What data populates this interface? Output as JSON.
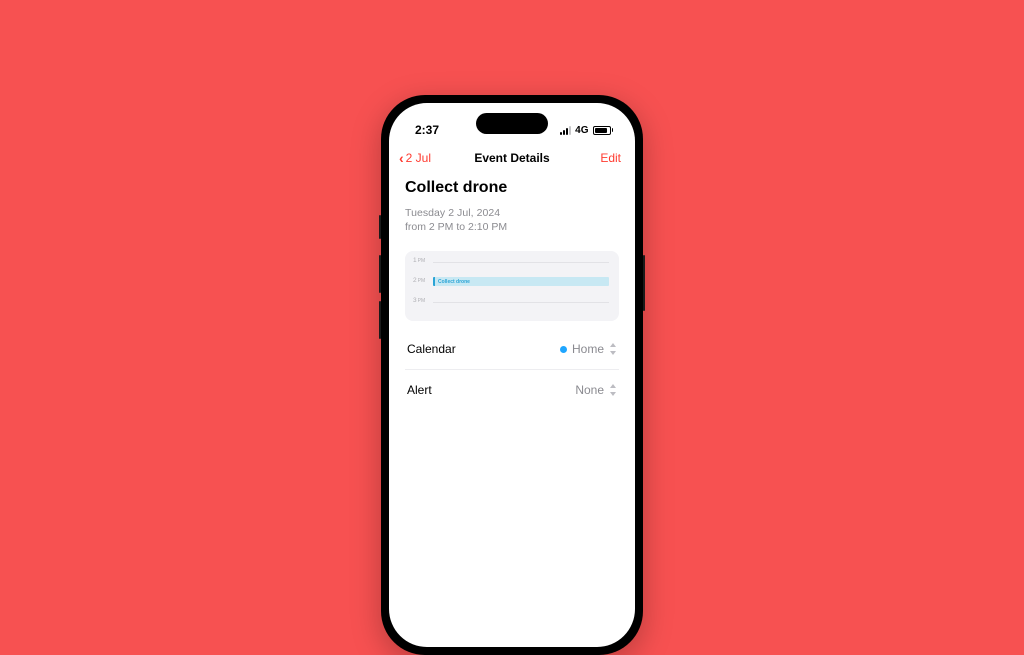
{
  "statusBar": {
    "time": "2:37",
    "network": "4G"
  },
  "nav": {
    "backLabel": "2 Jul",
    "title": "Event Details",
    "editLabel": "Edit"
  },
  "event": {
    "title": "Collect drone",
    "dateLine": "Tuesday 2 Jul, 2024",
    "timeLine": "from 2 PM to 2:10 PM",
    "blockLabel": "Collect drone"
  },
  "timeline": {
    "hour1": "1",
    "hour1ampm": "PM",
    "hour2": "2",
    "hour2ampm": "PM",
    "hour3": "3",
    "hour3ampm": "PM"
  },
  "rows": {
    "calendar": {
      "label": "Calendar",
      "value": "Home",
      "dotColor": "#1fa6ff"
    },
    "alert": {
      "label": "Alert",
      "value": "None"
    }
  }
}
